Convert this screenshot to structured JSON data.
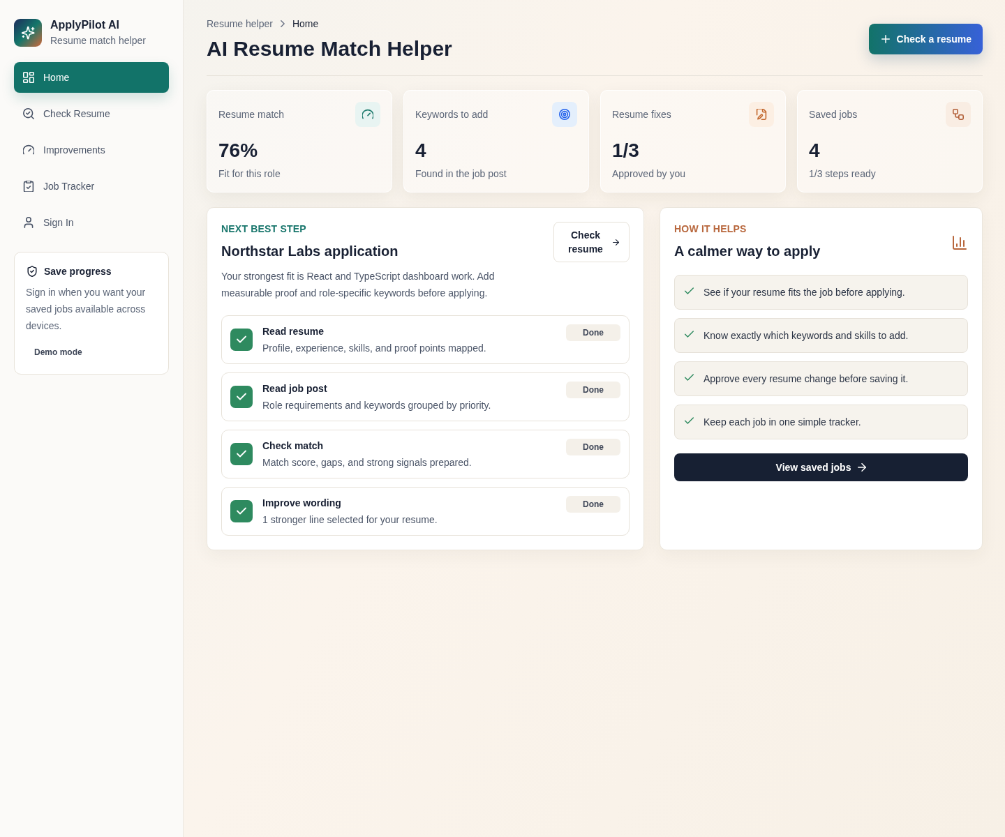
{
  "sidebar": {
    "brand": {
      "name": "ApplyPilot AI",
      "tagline": "Resume match helper"
    },
    "nav": [
      {
        "label": "Home",
        "selected": true
      },
      {
        "label": "Check Resume",
        "selected": false
      },
      {
        "label": "Improvements",
        "selected": false
      },
      {
        "label": "Job Tracker",
        "selected": false
      },
      {
        "label": "Sign In",
        "selected": false
      }
    ],
    "save_card": {
      "title": "Save progress",
      "text": "Sign in when you want your saved jobs available across devices.",
      "button": "Demo mode"
    }
  },
  "header": {
    "breadcrumb": [
      "Resume helper",
      "Home"
    ],
    "title": "AI Resume Match Helper",
    "action": "Check a resume"
  },
  "stats": [
    {
      "label": "Resume match",
      "value": "76%",
      "note": "Fit for this role"
    },
    {
      "label": "Keywords to add",
      "value": "4",
      "note": "Found in the job post"
    },
    {
      "label": "Resume fixes",
      "value": "1/3",
      "note": "Approved by you"
    },
    {
      "label": "Saved jobs",
      "value": "4",
      "note": "1/3 steps ready"
    }
  ],
  "next_step": {
    "eyebrow": "NEXT BEST STEP",
    "title": "Northstar Labs application",
    "button": "Check resume",
    "description": "Your strongest fit is React and TypeScript dashboard work. Add measurable proof and role-specific keywords before applying.",
    "steps": [
      {
        "title": "Read resume",
        "description": "Profile, experience, skills, and proof points mapped.",
        "checked": true,
        "status": "Done"
      },
      {
        "title": "Read job post",
        "description": "Role requirements and keywords grouped by priority.",
        "checked": true,
        "status": "Done"
      },
      {
        "title": "Check match",
        "description": "Match score, gaps, and strong signals prepared.",
        "checked": true,
        "status": "Done"
      },
      {
        "title": "Improve wording",
        "description": "1 stronger line selected for your resume.",
        "checked": true,
        "status": "Done"
      }
    ]
  },
  "how_it_helps": {
    "eyebrow": "HOW IT HELPS",
    "title": "A calmer way to apply",
    "benefits": [
      "See if your resume fits the job before applying.",
      "Know exactly which keywords and skills to add.",
      "Approve every resume change before saving it.",
      "Keep each job in one simple tracker."
    ],
    "button": "View saved jobs"
  }
}
